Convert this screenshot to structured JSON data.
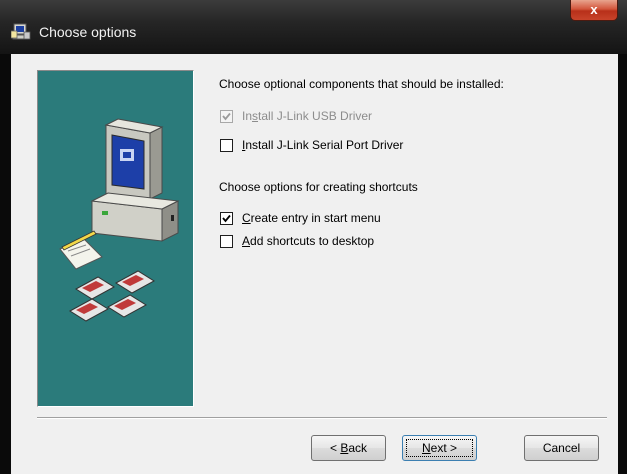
{
  "window": {
    "title": "Choose options",
    "close_label": "x"
  },
  "main": {
    "components_heading": "Choose optional components that should be installed:",
    "components": [
      {
        "pre": "In",
        "key": "s",
        "post": "tall J-Link USB Driver",
        "checked": true,
        "enabled": false
      },
      {
        "pre": "",
        "key": "I",
        "post": "nstall J-Link Serial Port Driver",
        "checked": false,
        "enabled": true
      }
    ],
    "shortcuts_heading": "Choose options for creating shortcuts",
    "shortcuts": [
      {
        "pre": "",
        "key": "C",
        "post": "reate entry in start menu",
        "checked": true,
        "enabled": true
      },
      {
        "pre": "",
        "key": "A",
        "post": "dd shortcuts to desktop",
        "checked": false,
        "enabled": true
      }
    ]
  },
  "buttons": {
    "back_pre": "< ",
    "back_key": "B",
    "back_post": "ack",
    "next_key": "N",
    "next_post": "ext >",
    "cancel": "Cancel"
  },
  "colors": {
    "side_panel": "#2b7b7b",
    "dialog_bg": "#f0f0f0",
    "close_button": "#c8432a"
  },
  "icons": {
    "title": "installer-computer-icon",
    "side_art": "computer-with-disks-illustration"
  }
}
